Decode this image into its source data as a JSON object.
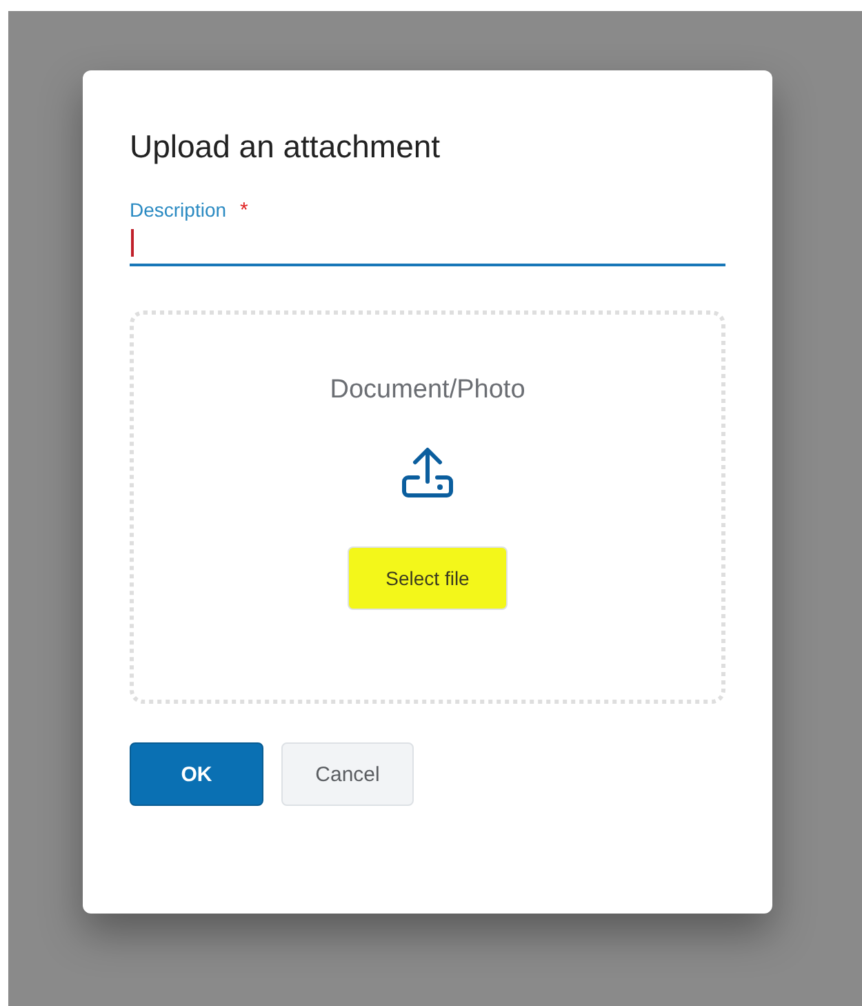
{
  "dialog": {
    "title": "Upload an attachment",
    "description_field": {
      "label": "Description",
      "required_mark": "*",
      "focused": true
    },
    "dropzone": {
      "heading": "Document/Photo",
      "select_button": {
        "label": "Select file",
        "highlighted": true
      }
    },
    "buttons": [
      {
        "label": "OK",
        "kind": "primary"
      },
      {
        "label": "Cancel",
        "kind": "secondary"
      }
    ]
  }
}
